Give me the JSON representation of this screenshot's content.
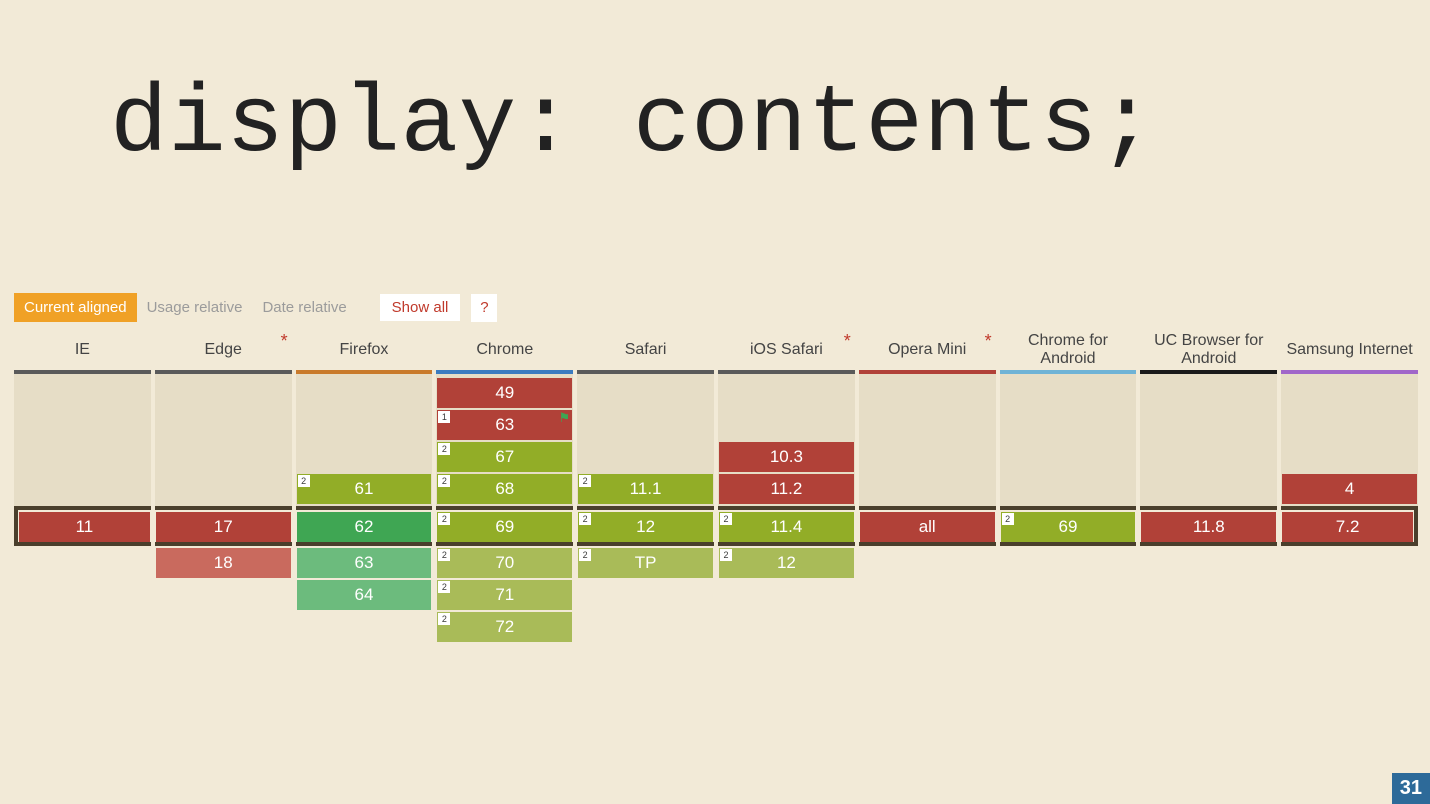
{
  "title": "display: contents;",
  "controls": {
    "tabs": [
      "Current aligned",
      "Usage relative",
      "Date relative"
    ],
    "active_tab": 0,
    "show_all": "Show all",
    "help": "?"
  },
  "colors": {
    "accent_orange": "#f0a126",
    "red": "#b14138",
    "red_light": "#c96a5e",
    "olive": "#92ad27",
    "olive_light": "#a9bb58",
    "green": "#3fa653",
    "green_light": "#6cbb7d",
    "current_border": "#4a3f2c"
  },
  "browsers": [
    {
      "name": "IE",
      "star": false,
      "underline": "#5a5a5a",
      "past": [],
      "current": {
        "v": "11",
        "c": "red"
      },
      "future": []
    },
    {
      "name": "Edge",
      "star": true,
      "underline": "#5a5a5a",
      "past": [],
      "current": {
        "v": "17",
        "c": "red"
      },
      "future": [
        {
          "v": "18",
          "c": "redl"
        }
      ]
    },
    {
      "name": "Firefox",
      "star": false,
      "underline": "#c97a2b",
      "past": [
        {
          "v": "61",
          "c": "olive",
          "note": "2"
        }
      ],
      "current": {
        "v": "62",
        "c": "green"
      },
      "future": [
        {
          "v": "63",
          "c": "greenl"
        },
        {
          "v": "64",
          "c": "greenl"
        }
      ]
    },
    {
      "name": "Chrome",
      "star": false,
      "underline": "#3b7bbf",
      "past": [
        {
          "v": "49",
          "c": "red"
        },
        {
          "v": "63",
          "c": "red",
          "note": "1",
          "flag": true
        },
        {
          "v": "67",
          "c": "olive",
          "note": "2"
        },
        {
          "v": "68",
          "c": "olive",
          "note": "2"
        }
      ],
      "current": {
        "v": "69",
        "c": "olive",
        "note": "2"
      },
      "future": [
        {
          "v": "70",
          "c": "olivel",
          "note": "2"
        },
        {
          "v": "71",
          "c": "olivel",
          "note": "2"
        },
        {
          "v": "72",
          "c": "olivel",
          "note": "2"
        }
      ]
    },
    {
      "name": "Safari",
      "star": false,
      "underline": "#5a5a5a",
      "past": [
        {
          "v": "11.1",
          "c": "olive",
          "note": "2"
        }
      ],
      "current": {
        "v": "12",
        "c": "olive",
        "note": "2"
      },
      "future": [
        {
          "v": "TP",
          "c": "olivel",
          "note": "2"
        }
      ]
    },
    {
      "name": "iOS Safari",
      "star": true,
      "underline": "#5a5a5a",
      "past": [
        {
          "v": "10.3",
          "c": "red"
        },
        {
          "v": "11.2",
          "c": "red"
        }
      ],
      "current": {
        "v": "11.4",
        "c": "olive",
        "note": "2"
      },
      "future": [
        {
          "v": "12",
          "c": "olivel",
          "note": "2"
        }
      ]
    },
    {
      "name": "Opera Mini",
      "star": true,
      "underline": "#b14138",
      "past": [],
      "current": {
        "v": "all",
        "c": "red"
      },
      "future": []
    },
    {
      "name": "Chrome for Android",
      "star": false,
      "underline": "#6fb3d6",
      "past": [],
      "current": {
        "v": "69",
        "c": "olive",
        "note": "2"
      },
      "future": []
    },
    {
      "name": "UC Browser for Android",
      "star": false,
      "underline": "#1a1a1a",
      "past": [],
      "current": {
        "v": "11.8",
        "c": "red"
      },
      "future": []
    },
    {
      "name": "Samsung Internet",
      "star": false,
      "underline": "#a066c9",
      "past": [
        {
          "v": "4",
          "c": "red"
        }
      ],
      "current": {
        "v": "7.2",
        "c": "red"
      },
      "future": []
    }
  ],
  "page_number": "31"
}
